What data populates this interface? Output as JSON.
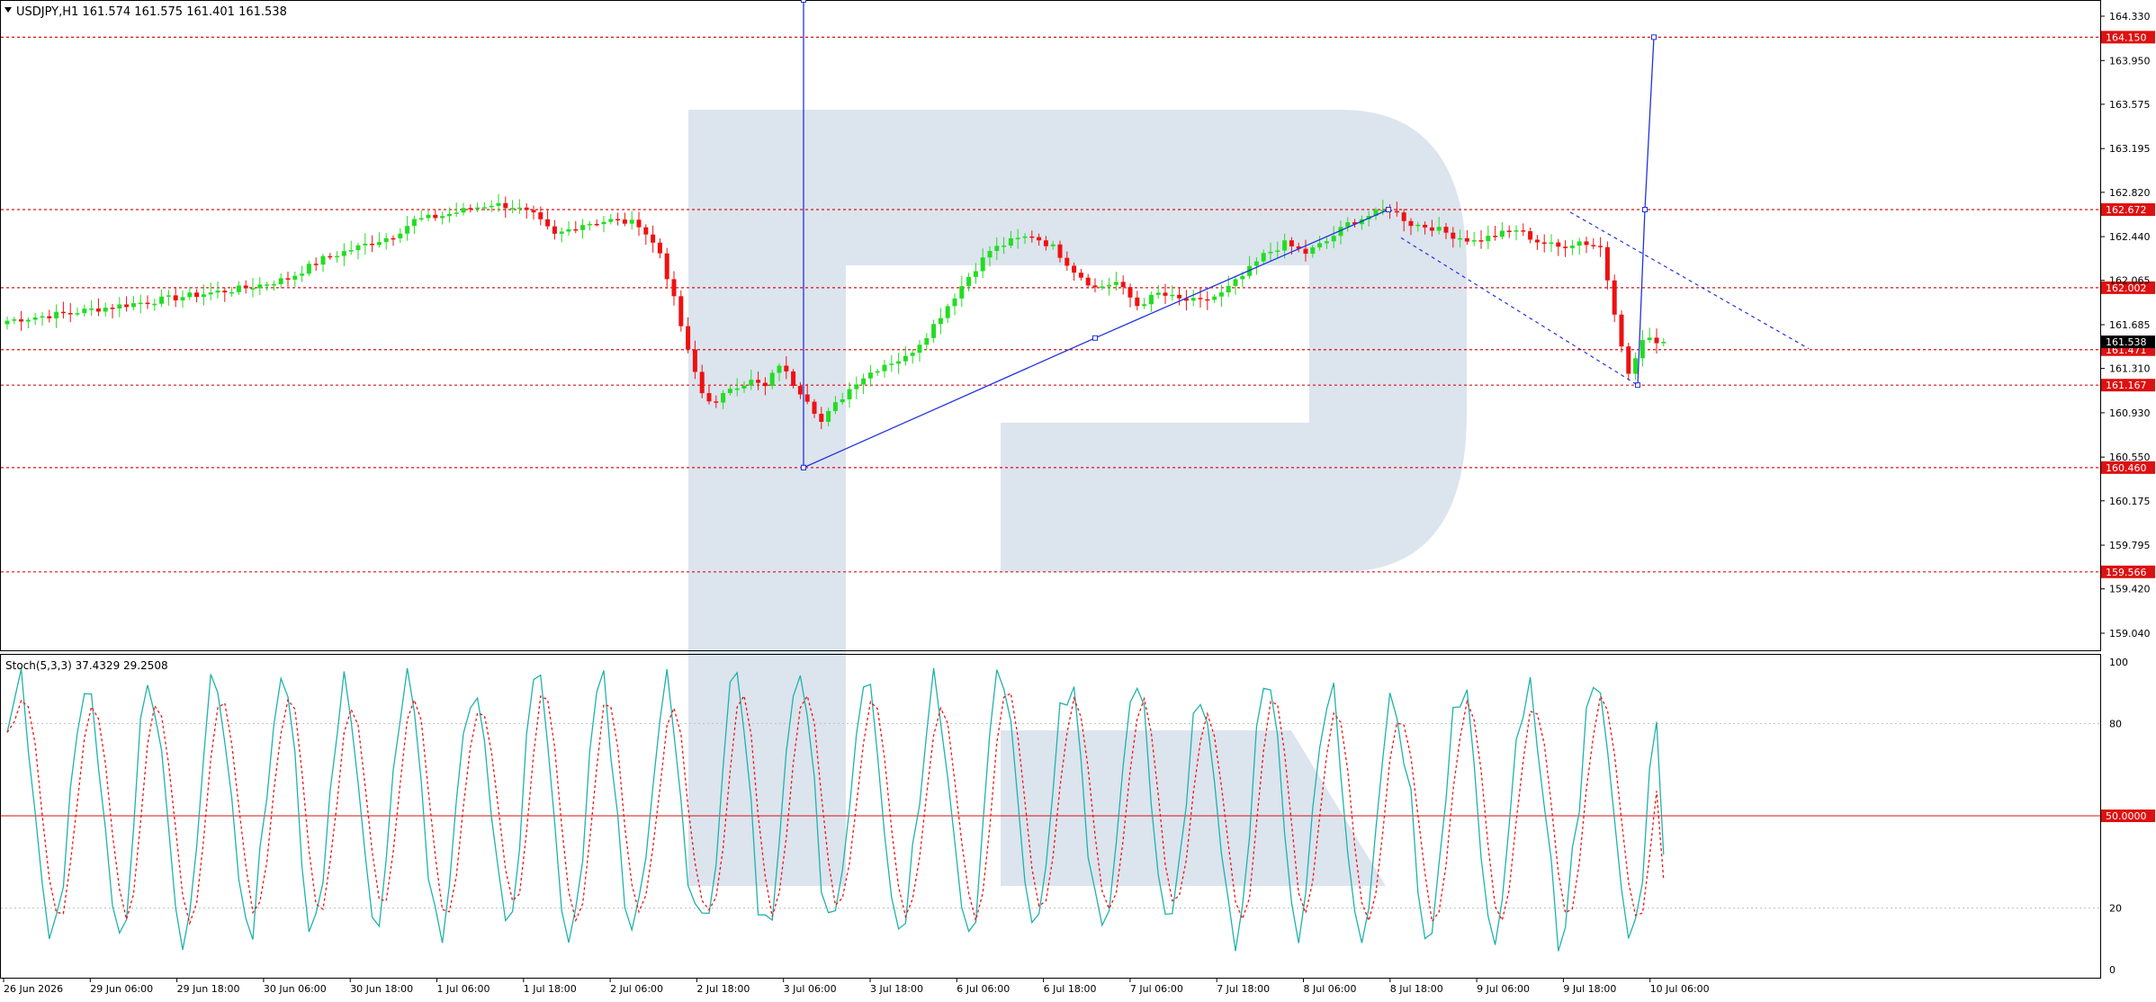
{
  "header": {
    "symbol_line": "USDJPY,H1  161.574 161.575 161.401 161.538",
    "indicator_line": "Stoch(5,3,3) 37.4329 29.2508"
  },
  "colors": {
    "bull": "#22dd22",
    "bear": "#ee1111",
    "level": "#dd1111",
    "trend": "#2233dd",
    "k_line": "#20b2aa",
    "d_line": "#ee1111",
    "watermark": "#dce4ee",
    "current_price_bg": "#000000"
  },
  "chart_data": [
    {
      "type": "candlestick",
      "title": "USDJPY,H1",
      "ohlc_readout": {
        "open": 161.574,
        "high": 161.575,
        "low": 161.401,
        "close": 161.538
      },
      "ylim": [
        158.9,
        164.4
      ],
      "y_ticks": [
        "164.330",
        "163.950",
        "163.575",
        "163.195",
        "162.820",
        "162.440",
        "162.065",
        "161.685",
        "161.310",
        "160.930",
        "160.550",
        "160.175",
        "159.795",
        "159.420",
        "159.040"
      ],
      "x_ticks": [
        "26 Jun 2026",
        "29 Jun 06:00",
        "29 Jun 18:00",
        "30 Jun 06:00",
        "30 Jun 18:00",
        "1 Jul 06:00",
        "1 Jul 18:00",
        "2 Jul 06:00",
        "2 Jul 18:00",
        "3 Jul 06:00",
        "3 Jul 18:00",
        "6 Jul 06:00",
        "6 Jul 18:00",
        "7 Jul 06:00",
        "7 Jul 18:00",
        "8 Jul 06:00",
        "8 Jul 18:00",
        "9 Jul 06:00",
        "9 Jul 18:00",
        "10 Jul 06:00"
      ],
      "levels": [
        {
          "value": 164.15,
          "label": "164.150"
        },
        {
          "value": 162.672,
          "label": "162.672"
        },
        {
          "value": 162.002,
          "label": "162.002"
        },
        {
          "value": 161.471,
          "label": "161.471"
        },
        {
          "value": 161.167,
          "label": "161.167"
        },
        {
          "value": 160.46,
          "label": "160.460"
        },
        {
          "value": 159.566,
          "label": "159.566"
        }
      ],
      "current_price": {
        "value": 161.538,
        "label": "161.538"
      },
      "anchors": [
        [
          0,
          161.72
        ],
        [
          8,
          161.78
        ],
        [
          15,
          161.84
        ],
        [
          22,
          161.9
        ],
        [
          28,
          161.95
        ],
        [
          34,
          162.0
        ],
        [
          40,
          162.08
        ],
        [
          45,
          162.25
        ],
        [
          50,
          162.35
        ],
        [
          55,
          162.45
        ],
        [
          58,
          162.58
        ],
        [
          62,
          162.62
        ],
        [
          66,
          162.68
        ],
        [
          69,
          162.72
        ],
        [
          72,
          162.7
        ],
        [
          75,
          162.62
        ],
        [
          78,
          162.45
        ],
        [
          82,
          162.55
        ],
        [
          86,
          162.58
        ],
        [
          90,
          162.55
        ],
        [
          93,
          162.3
        ],
        [
          95,
          161.9
        ],
        [
          97,
          161.45
        ],
        [
          99,
          161.1
        ],
        [
          101,
          161.0
        ],
        [
          103,
          161.15
        ],
        [
          106,
          161.2
        ],
        [
          108,
          161.15
        ],
        [
          110,
          161.35
        ],
        [
          112,
          161.18
        ],
        [
          114,
          161.05
        ],
        [
          116,
          160.85
        ],
        [
          118,
          161.0
        ],
        [
          121,
          161.2
        ],
        [
          125,
          161.35
        ],
        [
          128,
          161.4
        ],
        [
          131,
          161.6
        ],
        [
          134,
          161.85
        ],
        [
          137,
          162.1
        ],
        [
          140,
          162.32
        ],
        [
          143,
          162.4
        ],
        [
          146,
          162.45
        ],
        [
          149,
          162.35
        ],
        [
          152,
          162.15
        ],
        [
          155,
          162.0
        ],
        [
          158,
          162.05
        ],
        [
          161,
          161.85
        ],
        [
          164,
          161.95
        ],
        [
          167,
          161.9
        ],
        [
          170,
          161.88
        ],
        [
          173,
          161.95
        ],
        [
          176,
          162.1
        ],
        [
          179,
          162.28
        ],
        [
          182,
          162.38
        ],
        [
          185,
          162.3
        ],
        [
          188,
          162.4
        ],
        [
          191,
          162.55
        ],
        [
          194,
          162.62
        ],
        [
          197,
          162.68
        ],
        [
          200,
          162.55
        ],
        [
          203,
          162.52
        ],
        [
          206,
          162.45
        ],
        [
          209,
          162.4
        ],
        [
          212,
          162.45
        ],
        [
          215,
          162.5
        ],
        [
          218,
          162.4
        ],
        [
          221,
          162.35
        ],
        [
          224,
          162.4
        ],
        [
          227,
          162.35
        ],
        [
          229,
          161.8
        ],
        [
          231,
          161.25
        ],
        [
          233,
          161.55
        ],
        [
          235,
          161.55
        ],
        [
          236,
          161.54
        ]
      ],
      "trend_lines": [
        {
          "points": [
            [
              0,
              164.7
            ],
            [
              0,
              160.46
            ]
          ],
          "style": "solid"
        },
        {
          "points": [
            [
              0,
              160.46
            ],
            [
              6,
              161.571
            ],
            [
              13,
              162.672
            ]
          ],
          "style": "solid"
        },
        {
          "points": [
            [
              0,
              161.167
            ],
            [
              1,
              162.672
            ],
            [
              2,
              164.15
            ]
          ],
          "style": "solid"
        },
        {
          "points": [
            [
              0,
              162.45
            ],
            [
              1,
              161.167
            ]
          ],
          "style": "dashed"
        },
        {
          "points": [
            [
              0,
              162.65
            ],
            [
              1,
              161.48
            ]
          ],
          "style": "dashed"
        }
      ]
    },
    {
      "type": "line",
      "title": "Stoch(5,3,3)",
      "ylim": [
        0,
        100
      ],
      "y_ticks": [
        "100",
        "80",
        "50.0000",
        "20",
        "0"
      ],
      "levels": [
        {
          "value": 80
        },
        {
          "value": 50,
          "label": "50.0000"
        },
        {
          "value": 20
        }
      ],
      "series": [
        {
          "name": "Main",
          "last_value": 37.4329
        },
        {
          "name": "Signal",
          "last_value": 29.2508
        }
      ]
    }
  ]
}
